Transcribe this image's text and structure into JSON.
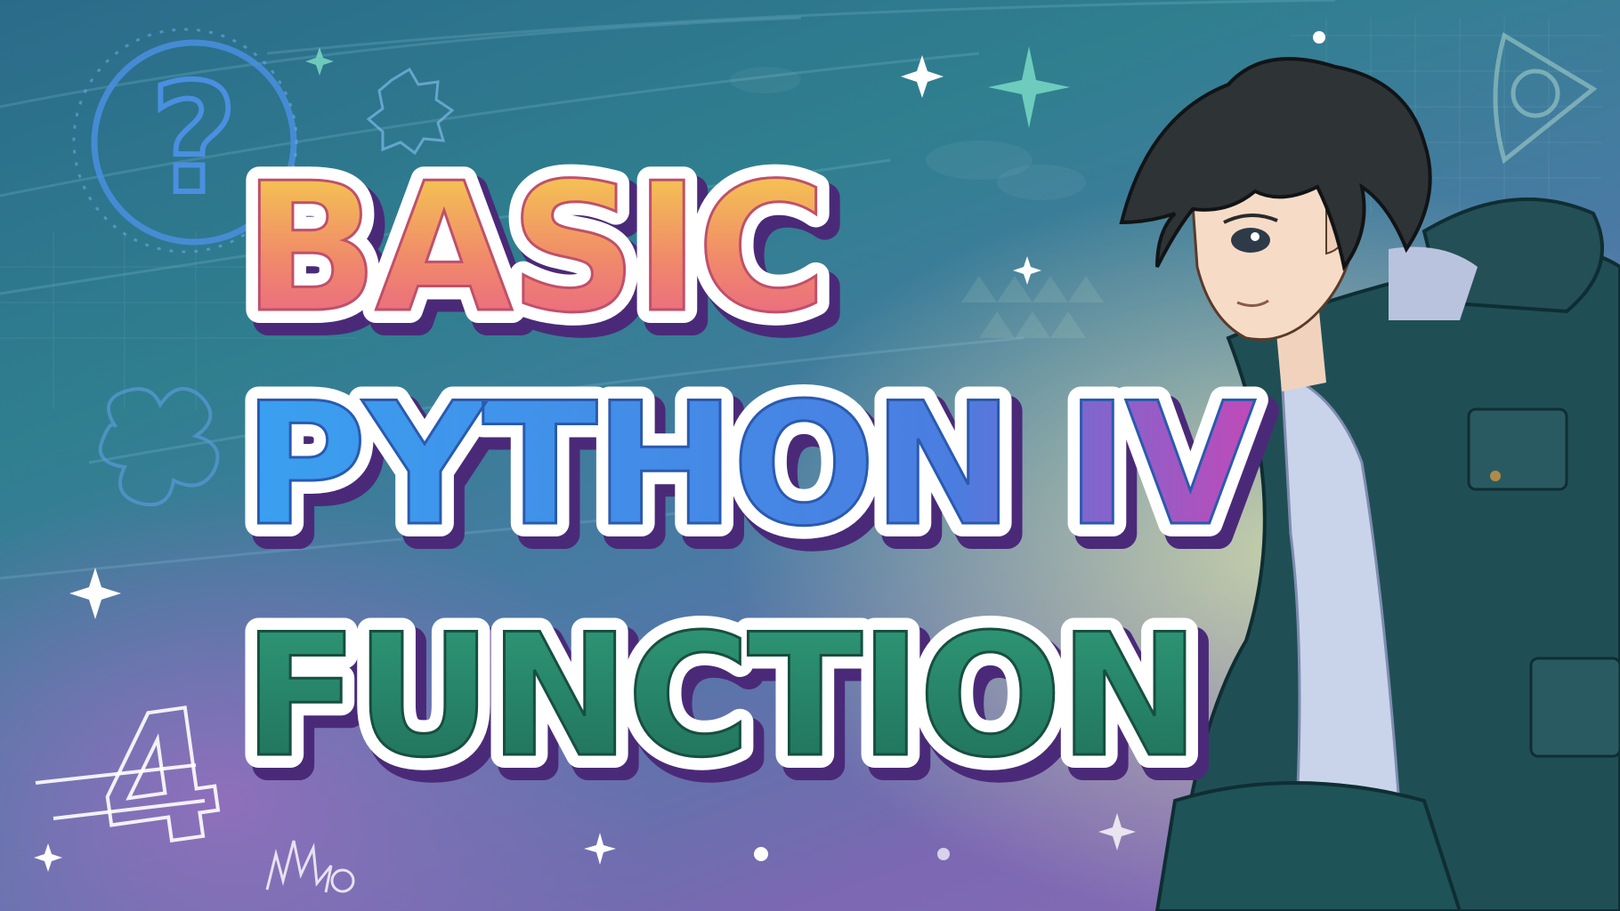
{
  "title": {
    "line1": "BASIC",
    "line2": "PYTHON IV",
    "line3": "FUNCTION"
  },
  "decorations": {
    "question_mark": "?",
    "number_badge": "4",
    "icons": [
      "question-circle-icon",
      "gear-doodle-icon",
      "puzzle-doodle-icon",
      "sparkle-icon",
      "play-button-icon"
    ]
  },
  "colors": {
    "line1_gradient": [
      "#f6d84a",
      "#f08a6a",
      "#e85a8e"
    ],
    "line2_gradient": [
      "#3aa0f0",
      "#4a7de0",
      "#c04ab8"
    ],
    "line3_gradient": [
      "#2f9a78",
      "#1f6e58"
    ],
    "outline": "#ffffff",
    "shadow": "#4a2a78"
  }
}
